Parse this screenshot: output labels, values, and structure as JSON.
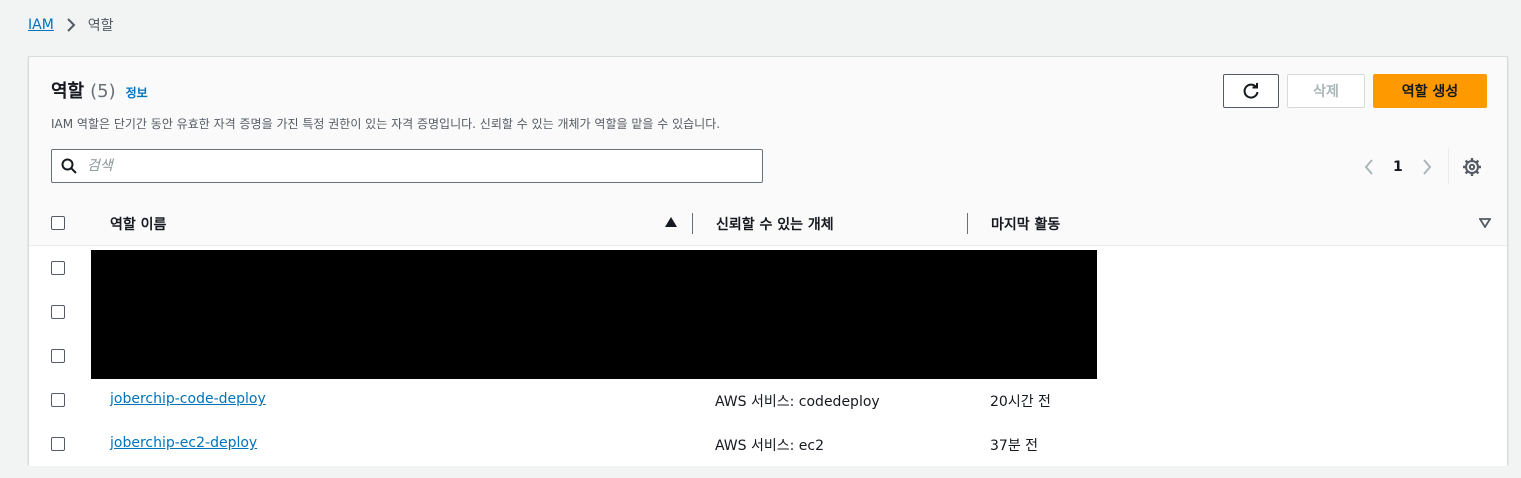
{
  "breadcrumb": {
    "items": [
      "IAM",
      "역할"
    ]
  },
  "panel": {
    "title": "역할",
    "count": "(5)",
    "info_link": "정보",
    "description": "IAM 역할은 단기간 동안 유효한 자격 증명을 가진 특정 권한이 있는 자격 증명입니다. 신뢰할 수 있는 개체가 역할을 맡을 수 있습니다.",
    "buttons": {
      "refresh_icon": "refresh-icon",
      "delete": "삭제",
      "create": "역할 생성"
    },
    "search": {
      "placeholder": "검색",
      "value": ""
    },
    "pagination": {
      "current_page": "1"
    }
  },
  "table": {
    "columns": [
      "역할 이름",
      "신뢰할 수 있는 개체",
      "마지막 활동"
    ],
    "sorted_column": "역할 이름",
    "sort_direction": "ascending",
    "rows": [
      {
        "name": "",
        "trusted_entity": "",
        "last_activity": "",
        "redacted": true
      },
      {
        "name": "",
        "trusted_entity": "",
        "last_activity": "",
        "redacted": true
      },
      {
        "name": "",
        "trusted_entity": "",
        "last_activity": "",
        "redacted": true
      },
      {
        "name": "joberchip-code-deploy",
        "trusted_entity": "AWS 서비스: codedeploy",
        "last_activity": "20시간 전"
      },
      {
        "name": "joberchip-ec2-deploy",
        "trusted_entity": "AWS 서비스: ec2",
        "last_activity": "37분 전"
      }
    ]
  },
  "colors": {
    "link": "#0073bb",
    "primary_button": "#ff9900",
    "page_background": "#f2f3f3",
    "redaction": "#000000"
  }
}
